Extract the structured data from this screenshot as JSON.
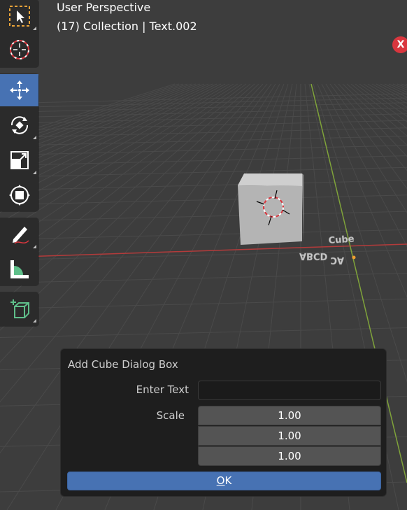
{
  "viewport": {
    "title": "User Perspective",
    "collection_info": "(17) Collection | Text.002",
    "close_label": "X",
    "scene_text_fragments": [
      "Cube",
      "ABCD",
      "AC"
    ]
  },
  "toolbar": {
    "tools": [
      {
        "name": "select-box",
        "icon": "select-box-icon",
        "active": false
      },
      {
        "name": "cursor",
        "icon": "cursor-icon",
        "active": false
      },
      {
        "name": "move",
        "icon": "move-icon",
        "active": true
      },
      {
        "name": "rotate",
        "icon": "rotate-icon",
        "active": false
      },
      {
        "name": "scale",
        "icon": "scale-icon",
        "active": false
      },
      {
        "name": "transform",
        "icon": "transform-icon",
        "active": false
      },
      {
        "name": "annotate",
        "icon": "annotate-icon",
        "active": false
      },
      {
        "name": "measure",
        "icon": "measure-icon",
        "active": false
      },
      {
        "name": "add-cube",
        "icon": "add-cube-icon",
        "active": false
      }
    ]
  },
  "dialog": {
    "title": "Add Cube Dialog Box",
    "enter_text_label": "Enter Text",
    "enter_text_value": "",
    "scale_label": "Scale",
    "scale_x": "1.00",
    "scale_y": "1.00",
    "scale_z": "1.00",
    "ok_label_first": "O",
    "ok_label_rest": "K"
  },
  "colors": {
    "background": "#3d3d3d",
    "active_tool": "#4772b3",
    "x_axis": "#b33b3b",
    "y_axis": "#7fa33a",
    "close_button": "#d9363e"
  }
}
